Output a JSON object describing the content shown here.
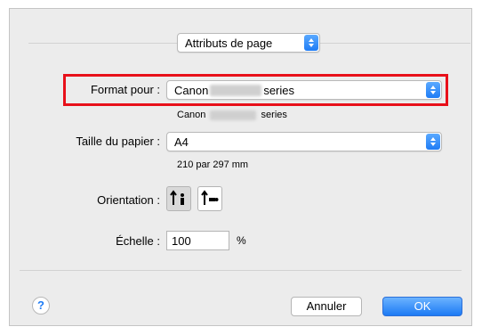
{
  "header": {
    "mode_popup_value": "Attributs de page"
  },
  "format_for": {
    "label": "Format pour :",
    "value_prefix": "Canon",
    "value_suffix": "series",
    "sub_prefix": "Canon",
    "sub_suffix": "series"
  },
  "paper_size": {
    "label": "Taille du papier :",
    "value": "A4",
    "dimensions": "210 par 297 mm"
  },
  "orientation": {
    "label": "Orientation :",
    "options": [
      "portrait",
      "landscape"
    ],
    "selected": "portrait"
  },
  "scale": {
    "label": "Échelle :",
    "value": "100",
    "unit": "%"
  },
  "footer": {
    "help_glyph": "?",
    "cancel_label": "Annuler",
    "ok_label": "OK"
  },
  "colors": {
    "accent": "#1f7cf5",
    "highlight": "#e8101a",
    "dialog_bg": "#ececec"
  }
}
